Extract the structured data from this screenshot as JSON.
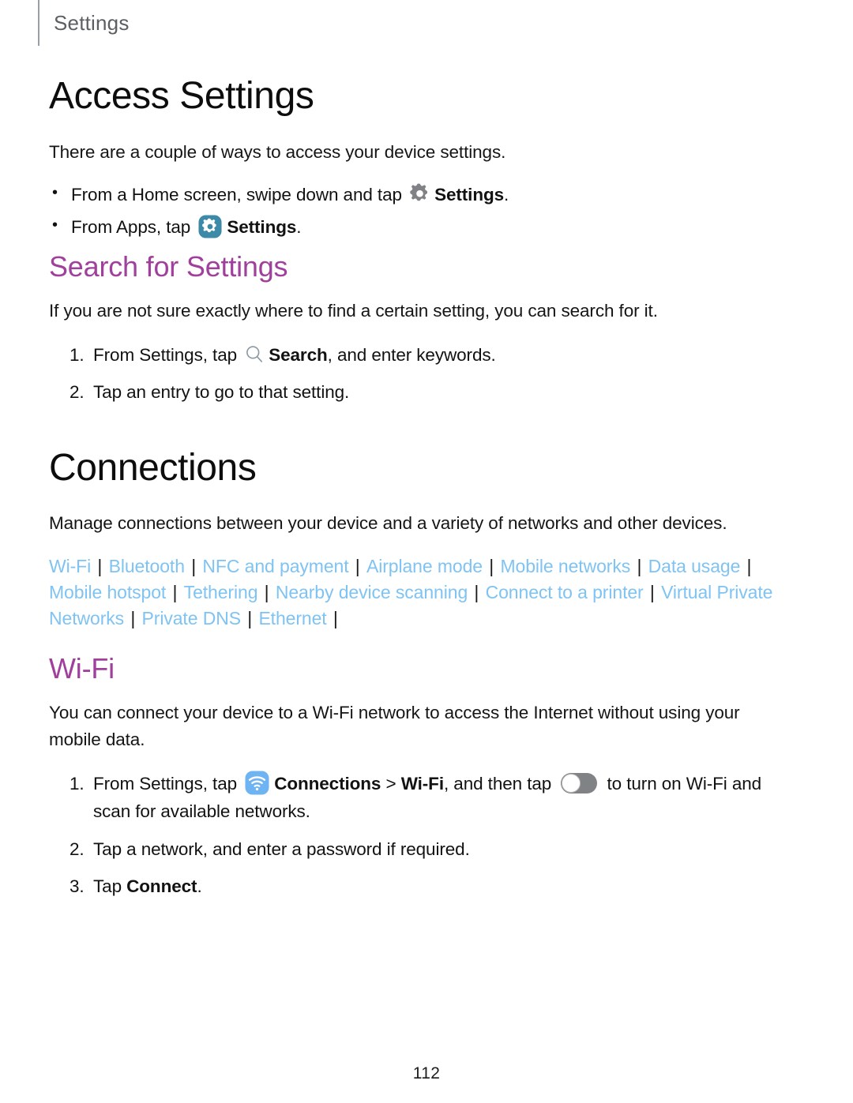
{
  "running_head": {
    "label": "Settings"
  },
  "sections": {
    "access_settings": {
      "title": "Access Settings",
      "intro": "There are a couple of ways to access your device settings.",
      "bullets": [
        {
          "before": "From a Home screen, swipe down and tap",
          "icon": "gear-gray-icon",
          "bold": "Settings",
          "after": "."
        },
        {
          "before": "From Apps, tap",
          "icon": "gear-blue-icon",
          "bold": "Settings",
          "after": "."
        }
      ]
    },
    "search_for_settings": {
      "heading": "Search for Settings",
      "intro": "If you are not sure exactly where to find a certain setting, you can search for it.",
      "steps": [
        {
          "before": "From Settings, tap",
          "icon": "search-icon",
          "bold": "Search",
          "after": ", and enter keywords."
        },
        {
          "text": "Tap an entry to go to that setting."
        }
      ]
    },
    "connections": {
      "title": "Connections",
      "intro": "Manage connections between your device and a variety of networks and other devices.",
      "links": [
        "Wi-Fi",
        "Bluetooth",
        "NFC and payment",
        "Airplane mode",
        "Mobile networks",
        "Data usage",
        "Mobile hotspot",
        "Tethering",
        "Nearby device scanning",
        "Connect to a printer",
        "Virtual Private Networks",
        "Private DNS",
        "Ethernet"
      ],
      "link_separator": "|"
    },
    "wifi": {
      "heading": "Wi-Fi",
      "intro": "You can connect your device to a Wi-Fi network to access the Internet without using your mobile data.",
      "steps": [
        {
          "before": "From Settings, tap",
          "icon": "wifi-icon",
          "bold1": "Connections",
          "chevron": ">",
          "bold2": "Wi-Fi",
          "mid": ", and then tap",
          "toggle": "toggle-off",
          "after": "to turn on Wi-Fi and scan for available networks."
        },
        {
          "text": "Tap a network, and enter a password if required."
        },
        {
          "before": "Tap",
          "bold": "Connect",
          "after": "."
        }
      ]
    }
  },
  "footer": {
    "page_number": "112"
  },
  "colors": {
    "heading_accent": "#A0409C",
    "link": "#7FC3F3",
    "gear_blue_bg": "#3D89A8",
    "wifi_blue_bg": "#6FB4F2",
    "gear_gray": "#808285",
    "toggle_track": "#808285",
    "running_head_text": "#5C6063"
  }
}
